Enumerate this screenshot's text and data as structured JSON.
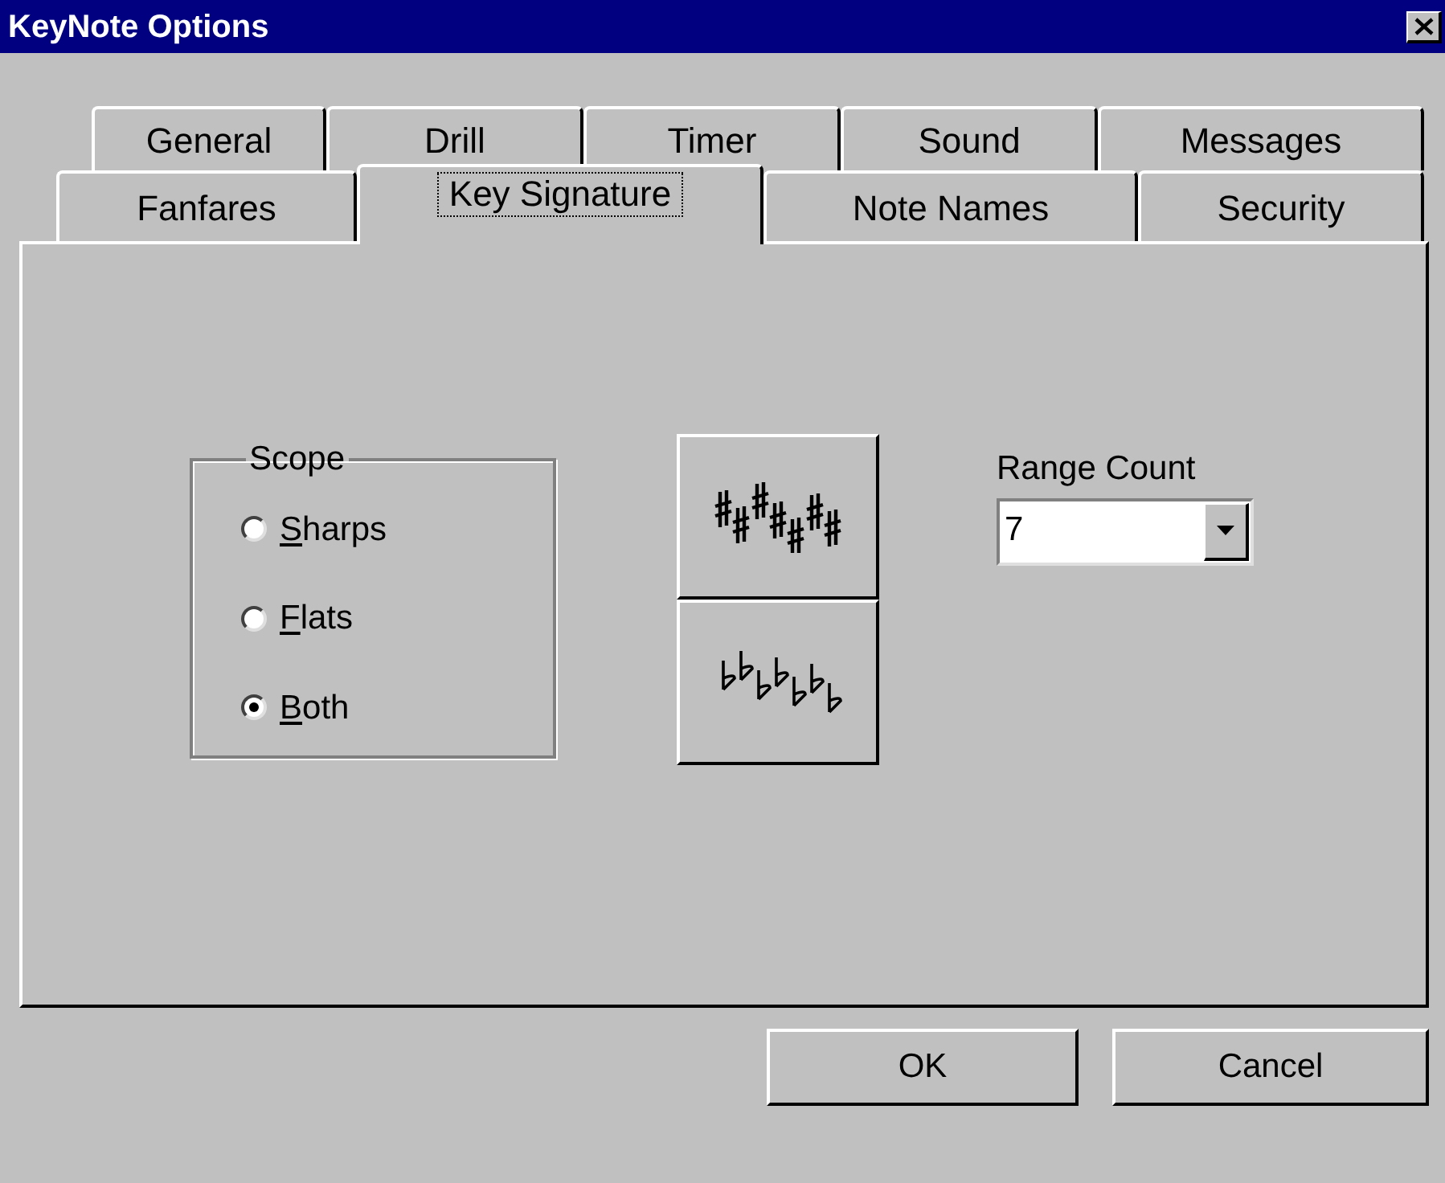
{
  "window": {
    "title": "KeyNote Options"
  },
  "tabs": [
    [
      {
        "label": "General",
        "selected": false
      },
      {
        "label": "Drill",
        "selected": false
      },
      {
        "label": "Timer",
        "selected": false
      },
      {
        "label": "Sound",
        "selected": false
      },
      {
        "label": "Messages",
        "selected": false
      }
    ],
    [
      {
        "label": "Fanfares",
        "selected": false
      },
      {
        "label": "Key Signature",
        "selected": true
      },
      {
        "label": "Note Names",
        "selected": false
      },
      {
        "label": "Security",
        "selected": false
      }
    ]
  ],
  "scope": {
    "label": "Scope",
    "options": [
      {
        "label": "Sharps",
        "selected": false,
        "mnemonic": true
      },
      {
        "label": "Flats",
        "selected": false,
        "mnemonic": true
      },
      {
        "label": "Both",
        "selected": true,
        "mnemonic": true
      }
    ]
  },
  "signature_buttons": [
    {
      "kind": "sharps"
    },
    {
      "kind": "flats"
    }
  ],
  "range_count": {
    "label": "Range Count",
    "value": "7"
  },
  "buttons": [
    "OK",
    "Cancel"
  ]
}
